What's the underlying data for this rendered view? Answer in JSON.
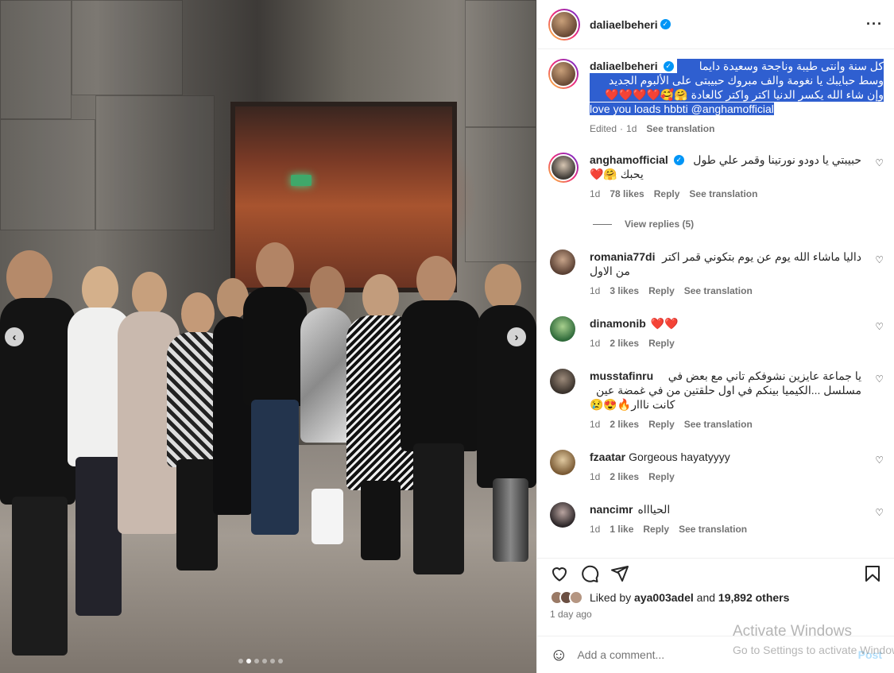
{
  "post": {
    "username": "daliaelbeheri",
    "more_icon": "more-icon"
  },
  "caption": {
    "username": "daliaelbeheri",
    "line1": "كل سنة وانتى طيبة وناجحة وسعيدة دايما",
    "line2": "وسط حبايبك يا نغومة والف مبروك حبيبتى على الألبوم الجديد",
    "line3": "وإن شاء الله يكسر الدنيا اكتر واكتر كالعادة 🤗🥰❤️❤️❤️❤️",
    "line4": "love you loads hbbti @anghamofficial",
    "edited": "Edited",
    "sep": "·",
    "time": "1d",
    "see_translation": "See translation"
  },
  "comments": [
    {
      "username": "anghamofficial",
      "verified": true,
      "text": "حبيبتي يا دودو نورتينا وقمر علي طول",
      "text2": "يحبك 🤗❤️",
      "time": "1d",
      "likes": "78 likes",
      "reply": "Reply",
      "see_translation": "See translation"
    },
    {
      "username": "romania77di",
      "text": "داليا ماشاء الله يوم عن يوم بتكوني قمر اكتر",
      "text2": "من الاول",
      "time": "1d",
      "likes": "3 likes",
      "reply": "Reply",
      "see_translation": "See translation"
    },
    {
      "username": "dinamonib",
      "text": "❤️❤️",
      "time": "1d",
      "likes": "2 likes",
      "reply": "Reply"
    },
    {
      "username": "musstafinru",
      "text": "يا جماعة عايزين نشوفكم تاني مع بعض في",
      "text2": "مسلسل ...الكيميا بينكم في اول حلقتين من في غمضة عين",
      "text3": "كانت نااار🔥😍😢",
      "time": "1d",
      "likes": "2 likes",
      "reply": "Reply",
      "see_translation": "See translation"
    },
    {
      "username": "fzaatar",
      "text": "Gorgeous hayatyyyy",
      "time": "1d",
      "likes": "2 likes",
      "reply": "Reply"
    },
    {
      "username": "nancimr",
      "text": "الحياااه",
      "time": "1d",
      "likes": "1 like",
      "reply": "Reply",
      "see_translation": "See translation"
    }
  ],
  "view_replies": "View replies (5)",
  "likes": {
    "prefix": "Liked by",
    "user": "aya003adel",
    "and": "and",
    "others": "19,892 others"
  },
  "time_ago": "1 day ago",
  "comment_input": {
    "placeholder": "Add a comment...",
    "post": "Post"
  },
  "watermark": {
    "title": "Activate Windows",
    "subtitle": "Go to Settings to activate Windows."
  },
  "colors": {
    "verified": "#0095f6",
    "selection": "#2f5fd0",
    "heart": "#ed4956"
  }
}
